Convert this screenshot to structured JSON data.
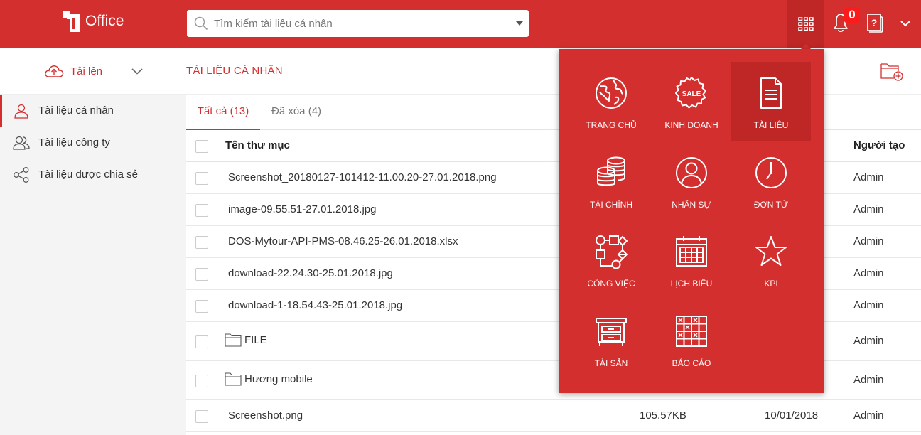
{
  "header": {
    "logo_text": "Office",
    "search_placeholder": "Tìm kiếm tài liệu cá nhân",
    "notification_count": "0",
    "colors": {
      "brand": "#d32f2f",
      "brand_dark": "#bf2626"
    }
  },
  "toolbar": {
    "upload_label": "Tải lên",
    "title": "TÀI LIỆU CÁ NHÂN"
  },
  "sidebar": {
    "items": [
      {
        "label": "Tài liệu cá nhân",
        "icon": "user-icon",
        "active": true
      },
      {
        "label": "Tài liệu công ty",
        "icon": "users-icon",
        "active": false
      },
      {
        "label": "Tài liệu được chia sẻ",
        "icon": "share-icon",
        "active": false
      }
    ]
  },
  "tabs": [
    {
      "label": "Tất cả (13)",
      "active": true
    },
    {
      "label": "Đã xóa (4)",
      "active": false
    }
  ],
  "table": {
    "columns": {
      "name": "Tên thư mục",
      "creator": "Người tạo"
    },
    "rows": [
      {
        "name": "Screenshot_20180127-101412-11.00.20-27.01.2018.png",
        "type": "file",
        "size": "",
        "date": "",
        "creator": "Admin"
      },
      {
        "name": "image-09.55.51-27.01.2018.jpg",
        "type": "file",
        "size": "",
        "date": "",
        "creator": "Admin"
      },
      {
        "name": "DOS-Mytour-API-PMS-08.46.25-26.01.2018.xlsx",
        "type": "file",
        "size": "",
        "date": "",
        "creator": "Admin"
      },
      {
        "name": "download-22.24.30-25.01.2018.jpg",
        "type": "file",
        "size": "",
        "date": "",
        "creator": "Admin"
      },
      {
        "name": "download-1-18.54.43-25.01.2018.jpg",
        "type": "file",
        "size": "",
        "date": "",
        "creator": "Admin"
      },
      {
        "name": "FILE",
        "type": "folder",
        "size": "",
        "date": "",
        "creator": "Admin"
      },
      {
        "name": "Hương mobile",
        "type": "folder",
        "size": "",
        "date": "",
        "creator": "Admin"
      },
      {
        "name": "Screenshot.png",
        "type": "file",
        "size": "105.57KB",
        "date": "10/01/2018",
        "creator": "Admin"
      }
    ]
  },
  "apps_menu": {
    "items": [
      {
        "label": "TRANG CHỦ",
        "icon": "globe-icon",
        "selected": false
      },
      {
        "label": "KINH DOANH",
        "icon": "sale-badge-icon",
        "selected": false
      },
      {
        "label": "TÀI LIỆU",
        "icon": "document-icon",
        "selected": true
      },
      {
        "label": "TÀI CHÍNH",
        "icon": "coins-icon",
        "selected": false
      },
      {
        "label": "NHÂN SỰ",
        "icon": "person-icon",
        "selected": false
      },
      {
        "label": "ĐƠN TỪ",
        "icon": "clock-icon",
        "selected": false
      },
      {
        "label": "CÔNG VIỆC",
        "icon": "workflow-icon",
        "selected": false
      },
      {
        "label": "LỊCH BIỂU",
        "icon": "calendar-icon",
        "selected": false
      },
      {
        "label": "KPI",
        "icon": "star-icon",
        "selected": false
      },
      {
        "label": "TÀI SẢN",
        "icon": "cabinet-icon",
        "selected": false
      },
      {
        "label": "BÁO CÁO",
        "icon": "report-grid-icon",
        "selected": false
      }
    ]
  }
}
